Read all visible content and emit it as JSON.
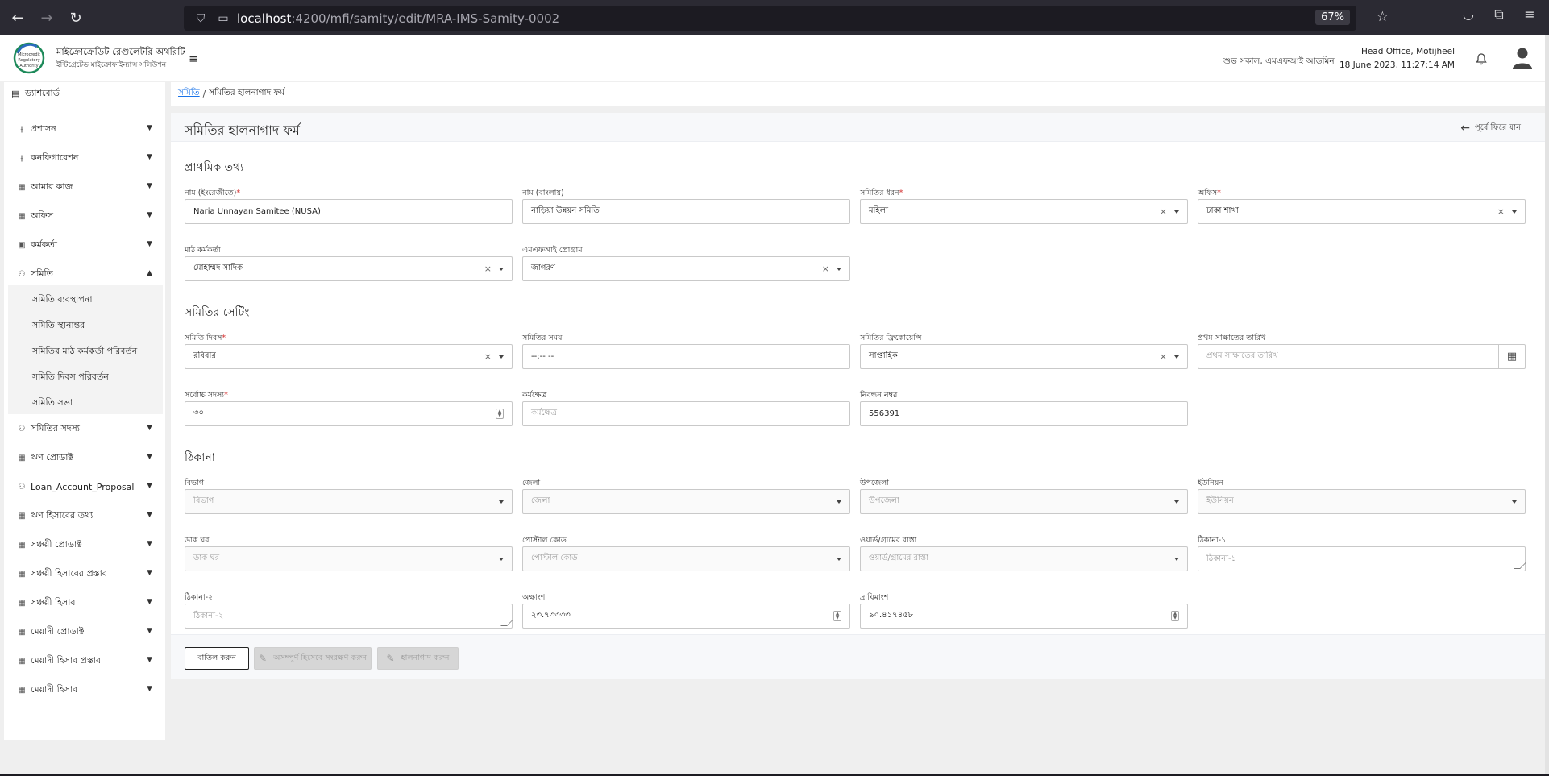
{
  "browser": {
    "url_host": "localhost",
    "url_path": ":4200/mfi/samity/edit/MRA-IMS-Samity-0002",
    "zoom": "67%"
  },
  "header": {
    "org_name": "মাইক্রোক্রেডিট রেগুলেটরি অথরিটি",
    "org_tagline": "ইন্টিগ্রেটেড মাইক্রোফাইন্যান্স সলিউশন",
    "logo_text": [
      "Microcredit",
      "Regulatory",
      "Authority"
    ],
    "greeting": "শুভ সকাল, এমএফআই আডমিন",
    "office": "Head Office, Motijheel",
    "datetime": "18 June 2023, 11:27:14 AM"
  },
  "sidebar": {
    "dashboard": "ড্যাশবোর্ড",
    "items": [
      {
        "label": "প্রশাসন",
        "icon": "sliders-icon",
        "expanded": false
      },
      {
        "label": "কনফিগারেশন",
        "icon": "sliders-icon",
        "expanded": false
      },
      {
        "label": "আমার কাজ",
        "icon": "building-icon",
        "expanded": false
      },
      {
        "label": "অফিস",
        "icon": "building-icon",
        "expanded": false
      },
      {
        "label": "কর্মকর্তা",
        "icon": "user-badge-icon",
        "expanded": false
      },
      {
        "label": "সমিতি",
        "icon": "group-icon",
        "expanded": true
      },
      {
        "label": "সমিতির সদস্য",
        "icon": "users-icon",
        "expanded": false
      },
      {
        "label": "ঋণ প্রোডাক্ট",
        "icon": "building-icon",
        "expanded": false
      },
      {
        "label": "Loan_Account_Proposal",
        "icon": "users-icon",
        "expanded": false
      },
      {
        "label": "ঋণ হিসাবের তথ্য",
        "icon": "building-icon",
        "expanded": false
      },
      {
        "label": "সঞ্চয়ী প্রোডাক্ট",
        "icon": "building-icon",
        "expanded": false
      },
      {
        "label": "সঞ্চয়ী হিসাবের প্রস্তাব",
        "icon": "building-icon",
        "expanded": false
      },
      {
        "label": "সঞ্চয়ী হিসাব",
        "icon": "building-icon",
        "expanded": false
      },
      {
        "label": "মেয়াদী প্রোডাক্ট",
        "icon": "building-icon",
        "expanded": false
      },
      {
        "label": "মেয়াদী হিসাব প্রস্তাব",
        "icon": "building-icon",
        "expanded": false
      },
      {
        "label": "মেয়াদী হিসাব",
        "icon": "building-icon",
        "expanded": false
      }
    ],
    "samity_sub": [
      "সমিতি ব্যবস্থাপনা",
      "সমিতি স্থানান্তর",
      "সমিতির মাঠ কর্মকর্তা পরিবর্তন",
      "সমিতি দিবস পরিবর্তন",
      "সমিতি সভা"
    ]
  },
  "breadcrumb": {
    "link": "সমিতি",
    "sep": "/",
    "current": "সমিতির হালনাগাদ ফর্ম"
  },
  "page": {
    "title": "সমিতির হালনাগাদ ফর্ম",
    "back": "পূর্বে ফিরে যান"
  },
  "sections": {
    "basic": "প্রাথমিক তথ্য",
    "setting": "সমিতির সেটিং",
    "address": "ঠিকানা"
  },
  "fields": {
    "name_en": {
      "label": "নাম (ইংরেজীতে)",
      "required": "*",
      "value": "Naria Unnayan Samitee (NUSA)"
    },
    "name_bn": {
      "label": "নাম (বাংলায়)",
      "value": "নাড়িয়া উন্নয়ন সমিতি"
    },
    "samity_type": {
      "label": "সমিতির ধরন",
      "required": "*",
      "value": "মহিলা"
    },
    "office": {
      "label": "অফিস",
      "required": "*",
      "value": "ঢাকা শাখা"
    },
    "field_officer": {
      "label": "মাঠ কর্মকর্তা",
      "value": "মোহাম্মদ সাদিক"
    },
    "mfi_program": {
      "label": "এমএফআই প্রোগ্রাম",
      "value": "জাগরণ"
    },
    "samity_day": {
      "label": "সমিতি দিবস",
      "required": "*",
      "value": "রবিবার"
    },
    "samity_time": {
      "label": "সমিতির সময়",
      "value": "--:-- --"
    },
    "frequency": {
      "label": "সমিতির ফ্রিকোয়েন্সি",
      "value": "সাপ্তাহিক"
    },
    "first_meeting": {
      "label": "প্রথম সাক্ষাতের তারিখ",
      "placeholder": "প্রথম সাক্ষাতের তারিখ"
    },
    "max_members": {
      "label": "সর্বোচ্চ সদস্য",
      "required": "*",
      "value": "৩০"
    },
    "work_area": {
      "label": "কর্মক্ষেত্র",
      "placeholder": "কর্মক্ষেত্র"
    },
    "reg_no": {
      "label": "নিবন্ধন নম্বর",
      "value": "556391"
    },
    "division": {
      "label": "বিভাগ",
      "placeholder": "বিভাগ"
    },
    "district": {
      "label": "জেলা",
      "placeholder": "জেলা"
    },
    "upazila": {
      "label": "উপজেলা",
      "placeholder": "উপজেলা"
    },
    "union": {
      "label": "ইউনিয়ন",
      "placeholder": "ইউনিয়ন"
    },
    "post_office": {
      "label": "ডাক ঘর",
      "placeholder": "ডাক ঘর"
    },
    "postal_code": {
      "label": "পোস্টাল কোড",
      "placeholder": "পোস্টাল কোড"
    },
    "ward": {
      "label": "ওয়ার্ড/গ্রামের রাস্তা",
      "placeholder": "ওয়ার্ড/গ্রামের রাস্তা"
    },
    "address1": {
      "label": "ঠিকানা-১",
      "placeholder": "ঠিকানা-১"
    },
    "address2": {
      "label": "ঠিকানা-২",
      "placeholder": "ঠিকানা-২"
    },
    "latitude": {
      "label": "অক্ষাংশ",
      "value": "২৩.৭৩৩৩৩"
    },
    "longitude": {
      "label": "দ্রাঘিমাংশ",
      "value": "৯০.৪১৭৪৫৮"
    }
  },
  "actions": {
    "cancel": "বাতিল করুন",
    "save_draft": "অসম্পূর্ণ হিসেবে সংরক্ষণ করুন",
    "update": "হালনাগাদ করুন"
  }
}
